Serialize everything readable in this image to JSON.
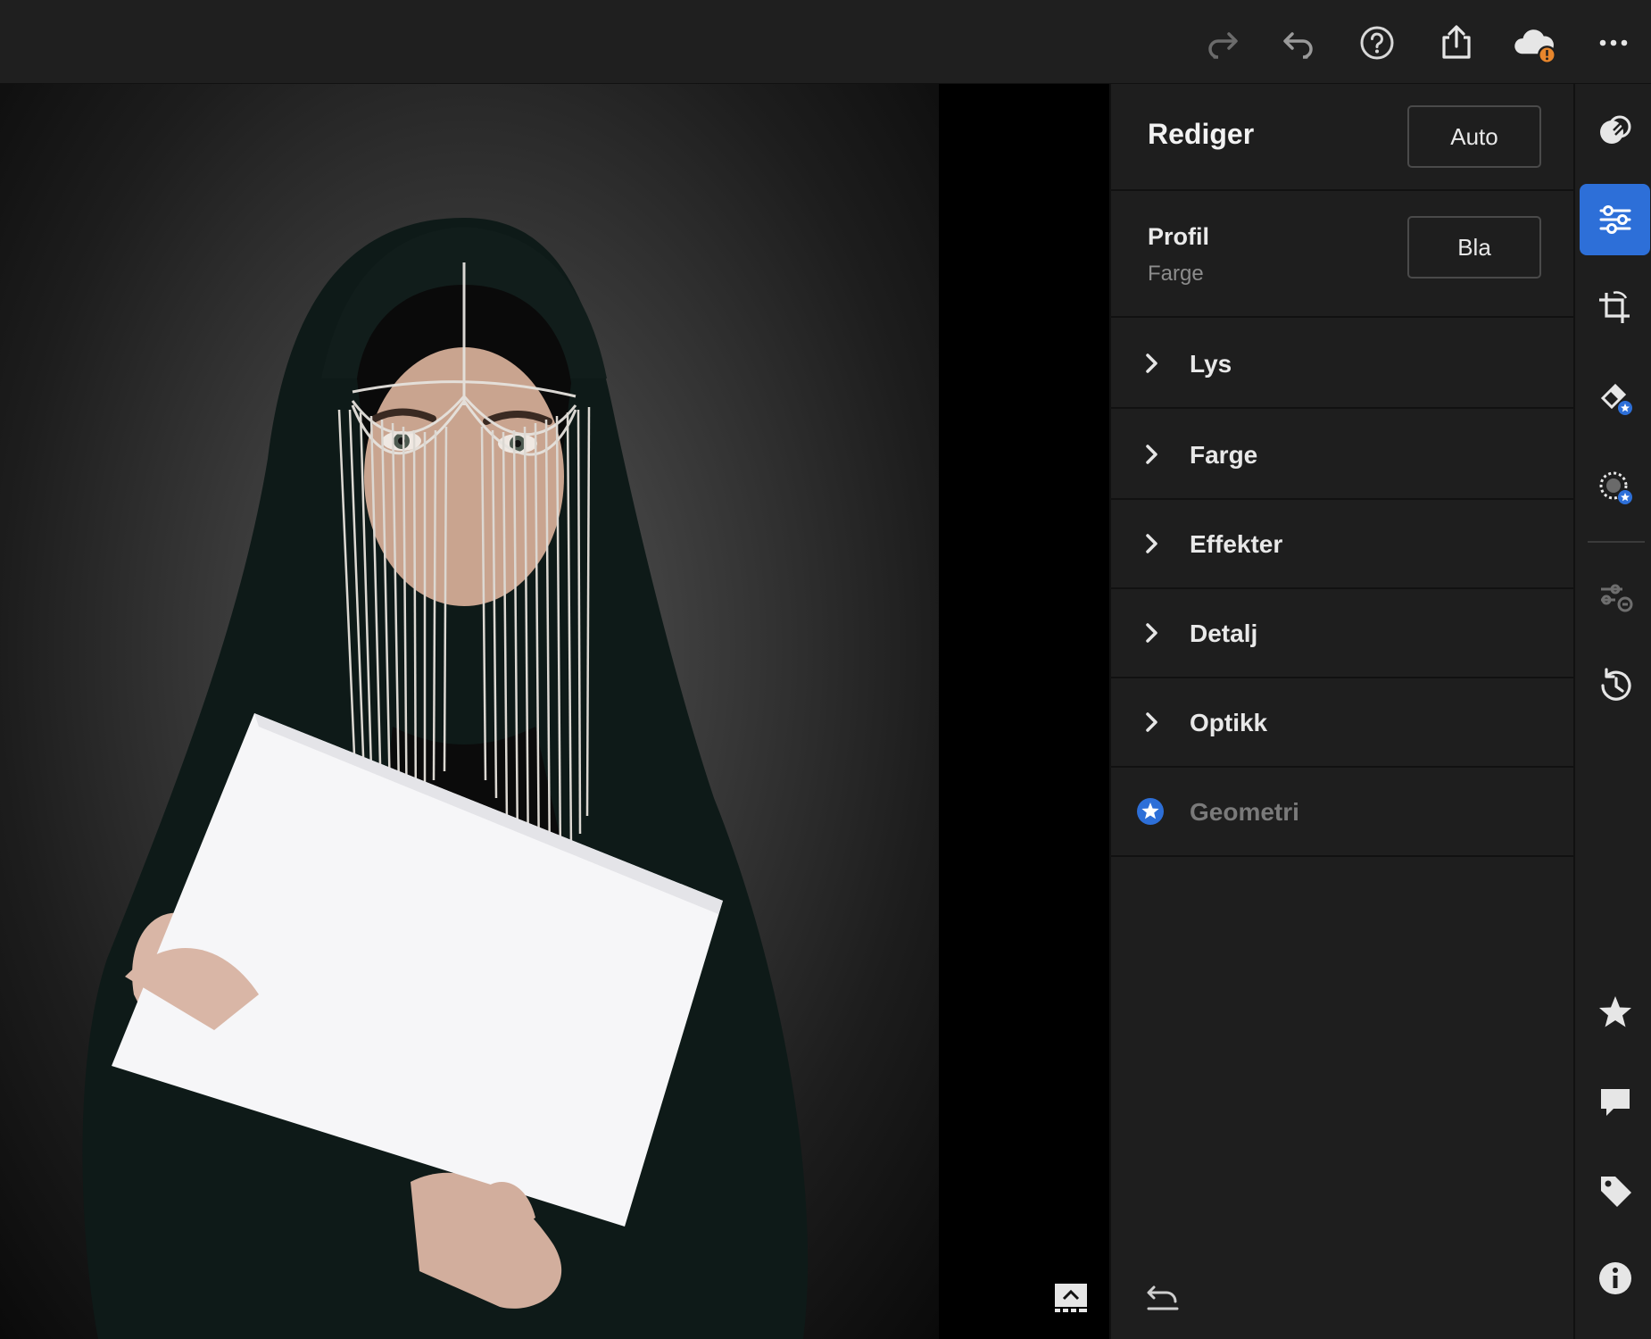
{
  "topbar": {
    "icons": [
      "redo-icon",
      "undo-icon",
      "help-icon",
      "share-icon",
      "cloud-sync-warning-icon",
      "more-icon"
    ],
    "warning_color": "#e8862c"
  },
  "panel": {
    "title": "Rediger",
    "auto_label": "Auto",
    "profile": {
      "label": "Profil",
      "value": "Farge",
      "browse_label": "Bla"
    },
    "sections": [
      {
        "label": "Lys",
        "enabled": true
      },
      {
        "label": "Farge",
        "enabled": true
      },
      {
        "label": "Effekter",
        "enabled": true
      },
      {
        "label": "Detalj",
        "enabled": true
      },
      {
        "label": "Optikk",
        "enabled": true
      },
      {
        "label": "Geometri",
        "enabled": false,
        "premium": true
      }
    ]
  },
  "toolbar": {
    "tools": [
      "presets-icon",
      "edit-sliders-icon",
      "crop-rotate-icon",
      "healing-brush-icon",
      "masking-icon",
      "versions-icon",
      "history-icon",
      "rating-star-icon",
      "comments-icon",
      "keyword-tag-icon",
      "info-icon"
    ],
    "active_tool": "edit-sliders-icon",
    "accent_color": "#2d6fd8",
    "premium_badge_color": "#2d6fd8"
  }
}
